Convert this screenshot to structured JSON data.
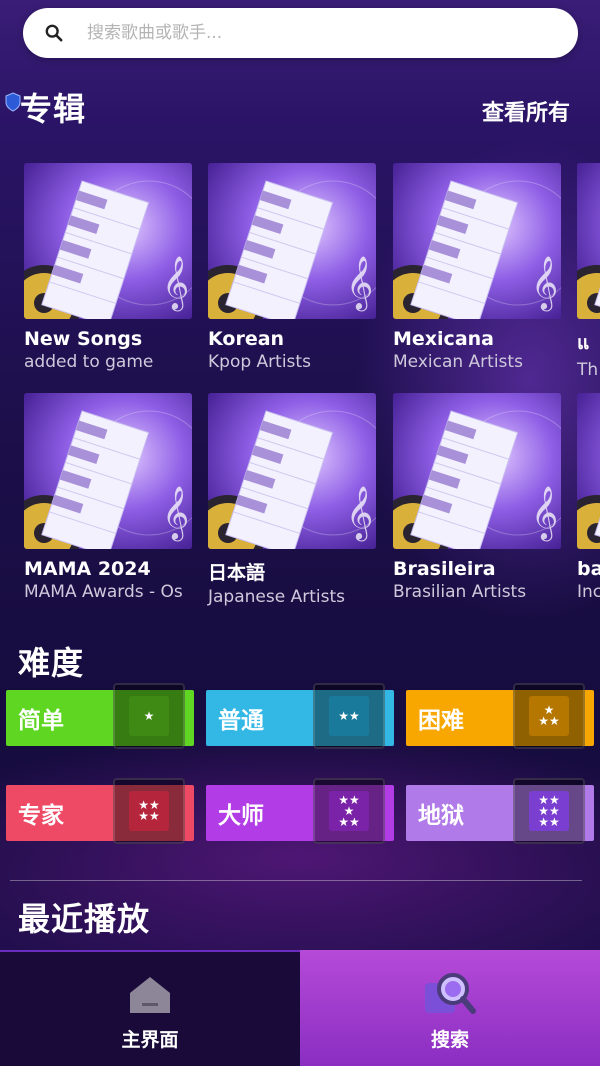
{
  "search": {
    "placeholder": "搜索歌曲或歌手..."
  },
  "albums_section": {
    "title": "专辑",
    "see_all": "查看所有"
  },
  "albums_row1": [
    {
      "title": "New Songs",
      "subtitle": "added to game"
    },
    {
      "title": "Korean",
      "subtitle": "Kpop Artists"
    },
    {
      "title": "Mexicana",
      "subtitle": "Mexican Artists"
    },
    {
      "title": "แ",
      "subtitle": "Th"
    }
  ],
  "albums_row2": [
    {
      "title": "MAMA 2024",
      "subtitle": "MAMA Awards - Os"
    },
    {
      "title": "日本語",
      "subtitle": "Japanese Artists"
    },
    {
      "title": "Brasileira",
      "subtitle": "Brasilian Artists"
    },
    {
      "title": "ba",
      "subtitle": "Inc"
    }
  ],
  "difficulty_section": {
    "title": "难度"
  },
  "difficulties": [
    {
      "label": "简单",
      "stars": 1,
      "color": "#5ed622",
      "badge_color": "#3f8a14"
    },
    {
      "label": "普通",
      "stars": 2,
      "color": "#33b8e6",
      "badge_color": "#1a7a9c"
    },
    {
      "label": "困难",
      "stars": 3,
      "color": "#f7a700",
      "badge_color": "#b57700"
    },
    {
      "label": "专家",
      "stars": 4,
      "color": "#ee4a66",
      "badge_color": "#b5263c"
    },
    {
      "label": "大师",
      "stars": 5,
      "color": "#b23ce6",
      "badge_color": "#7b23a8"
    },
    {
      "label": "地狱",
      "stars": 6,
      "color": "#b07ae8",
      "badge_color": "#7a3fd0"
    }
  ],
  "recent_section": {
    "title": "最近播放"
  },
  "tabbar": {
    "home_label": "主界面",
    "search_label": "搜索",
    "active_tab": "search"
  }
}
